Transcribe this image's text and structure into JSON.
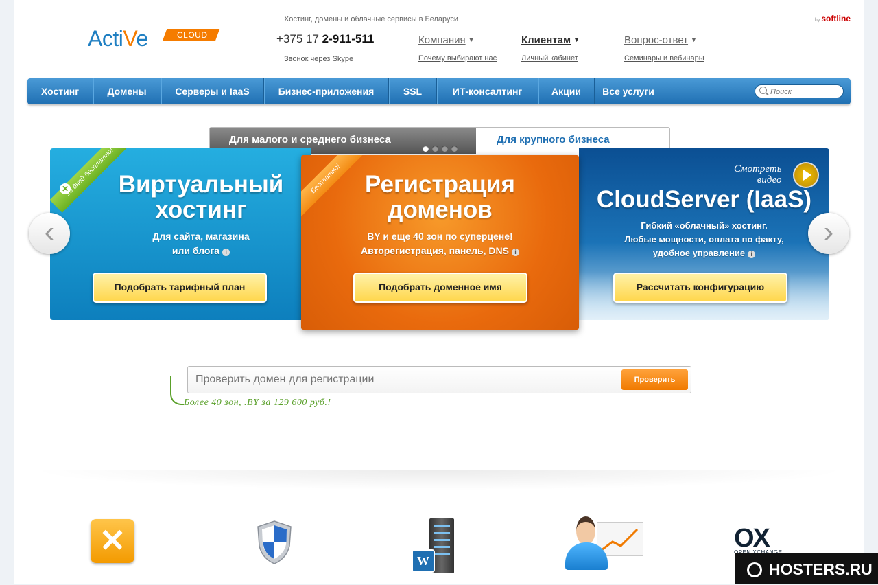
{
  "brand": {
    "word_start": "Acti",
    "word_v": "V",
    "word_end": "e",
    "cloud": "CLOUD",
    "partner_by": "by",
    "partner": "softline"
  },
  "header": {
    "tagline": "Хостинг, домены и облачные сервисы в Беларуси",
    "phone_prefix": "+375 17",
    "phone_number": "2-911-511",
    "skype": "Звонок через Skype",
    "nav": [
      {
        "label": "Компания",
        "sub": "Почему выбирают нас"
      },
      {
        "label": "Клиентам",
        "sub": "Личный кабинет"
      },
      {
        "label": "Вопрос-ответ",
        "sub": "Семинары и вебинары"
      }
    ]
  },
  "menu": {
    "items": [
      "Хостинг",
      "Домены",
      "Серверы и IaaS",
      "Бизнес-приложения",
      "SSL",
      "ИТ-консалтинг",
      "Акции",
      "Все услуги"
    ],
    "search_placeholder": "Поиск"
  },
  "segments": {
    "active": "Для малого и среднего бизнеса",
    "inactive": "Для крупного бизнеса",
    "slides_total": 4,
    "slide_current": 1
  },
  "slides": [
    {
      "ribbon": "10 дней бесплатно!",
      "title_1": "Виртуальный",
      "title_2": "хостинг",
      "desc_1": "Для сайта, магазина",
      "desc_2": "или блога",
      "button": "Подобрать тарифный план",
      "color": "#1a9ad3"
    },
    {
      "ribbon": "Бесплатно!",
      "title_1": "Регистрация",
      "title_2": "доменов",
      "desc_1": "BY и еще 40 зон по суперцене!",
      "desc_2": "Авторегистрация, панель, DNS",
      "button": "Подобрать доменное имя",
      "color": "#ee7412"
    },
    {
      "watch_1": "Смотреть",
      "watch_2": "видео",
      "title_1": "CloudServer (IaaS)",
      "desc_1": "Гибкий «облачный» хостинг.",
      "desc_2": "Любые мощности, оплата по факту,",
      "desc_3": "удобное управление",
      "button": "Рассчитать конфигурацию",
      "color": "#11599f"
    }
  ],
  "domain_check": {
    "placeholder": "Проверить домен для регистрации",
    "button": "Проверить",
    "hint": "Более 40 зон, .BY за 129 600 руб.!"
  },
  "bottom_icons": [
    "exchange-icon",
    "shield-icon",
    "wordpress-server-icon",
    "manager-icon",
    "open-xchange-logo"
  ],
  "ox_logo": {
    "big": "OX",
    "small": "OPEN XCHANGE"
  },
  "watermark": "HOSTERS.RU"
}
